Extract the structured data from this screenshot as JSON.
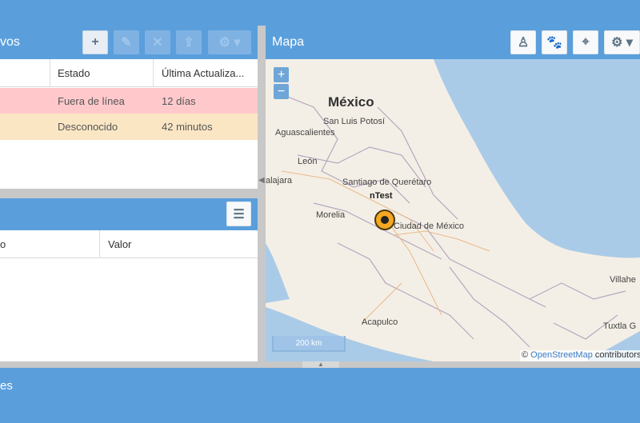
{
  "devices_panel": {
    "title": "vos",
    "columns": [
      "",
      "Estado",
      "Última Actualiza..."
    ],
    "rows": [
      {
        "status": "Fuera de línea",
        "last_update": "12 días",
        "color": "#ffc9cc"
      },
      {
        "status": "Desconocido",
        "last_update": "42 minutos",
        "color": "#fbe6c4"
      }
    ],
    "toolbar_icons": [
      "add-icon",
      "edit-icon",
      "remove-icon",
      "upload-icon",
      "gear-icon"
    ]
  },
  "state_panel": {
    "columns": [
      "o",
      "Valor"
    ],
    "toolbar_icon": "list-icon"
  },
  "map_panel": {
    "title": "Mapa",
    "toolbar_icons": [
      "person-icon",
      "paw-icon",
      "crosshair-icon",
      "gear-icon"
    ],
    "zoom_in": "+",
    "zoom_out": "−",
    "country_label": "México",
    "places": [
      "San Luis Potosí",
      "Aguascalientes",
      "León",
      "alajara",
      "Santiago de Querétaro",
      "Morelia",
      "Ciudad de México",
      "Acapulco",
      "Villahe",
      "Tuxtla G"
    ],
    "marker_label": "nTest",
    "scale": "200 km",
    "attribution_symbol": "©",
    "attribution_link": "OpenStreetMap",
    "attribution_suffix": "contributors"
  },
  "bottom_panel": {
    "title": "es"
  },
  "colors": {
    "header": "#5a9fdc",
    "offline_row": "#ffc9cc",
    "unknown_row": "#fbe6c4",
    "marker": "#f5a623"
  }
}
